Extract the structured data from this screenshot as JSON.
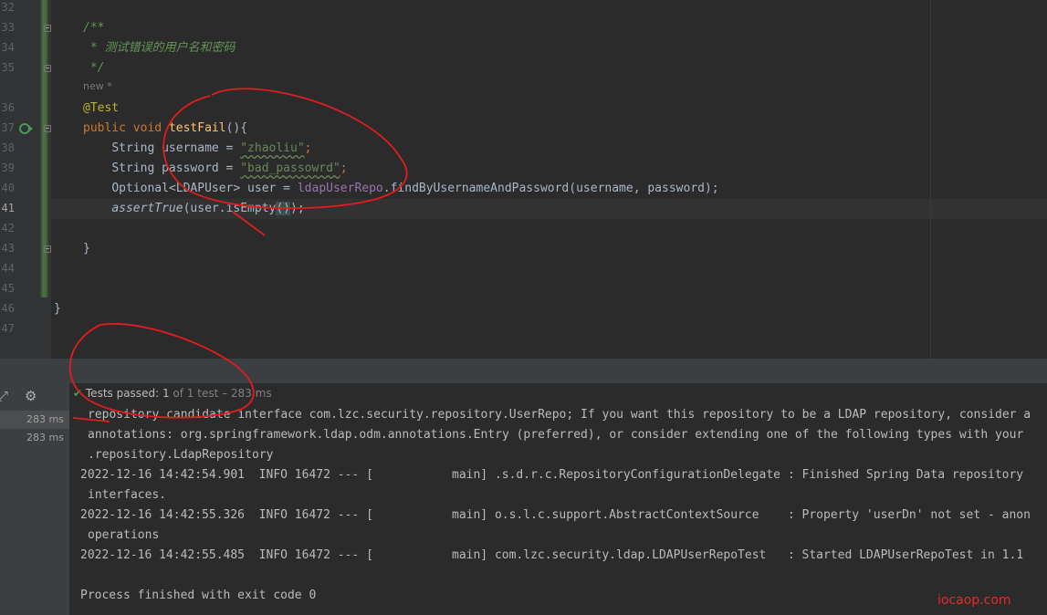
{
  "editor": {
    "line_numbers": [
      "32",
      "33",
      "34",
      "35",
      "36",
      "37",
      "38",
      "39",
      "40",
      "41",
      "42",
      "43",
      "44",
      "45",
      "46",
      "47"
    ],
    "comment_open": "/**",
    "comment_text": " * 测试错误的用户名和密码",
    "comment_close": " */",
    "hint": "new *",
    "annotation": "@Test",
    "kw_public": "public",
    "kw_void": "void",
    "method_name": "testFail",
    "method_sig_end": "(){",
    "type_string": "String",
    "var_username": "username",
    "eq": " = ",
    "str_username": "\"zhaoliu\"",
    "semi": ";",
    "var_password": "password",
    "str_password": "\"bad_passowrd\"",
    "type_optional": "Optional",
    "generic_open": "<",
    "type_ldapuser": "LDAPUser",
    "generic_close": ">",
    "var_user": "user",
    "field_repo": "ldapUserRepo",
    "dot": ".",
    "method_find": "findByUsernameAndPassword",
    "find_args": "(username, password);",
    "assert_call": "assertTrue",
    "assert_open": "(user.",
    "method_isempty": "isEmpty",
    "paren_pair": "()",
    "assert_close": ");",
    "close_method": "}",
    "close_class": "}"
  },
  "test_panel": {
    "status_prefix": "Tests passed:",
    "status_count": "1",
    "status_rest": "of 1 test",
    "status_time": "– 283 ms",
    "side_rows": [
      "283 ms",
      "283 ms"
    ],
    "console_lines": [
      "repository candidate interface com.lzc.security.repository.UserRepo; If you want this repository to be a LDAP repository, consider a",
      "annotations: org.springframework.ldap.odm.annotations.Entry (preferred), or consider extending one of the following types with your",
      ".repository.LdapRepository",
      "2022-12-16 14:42:54.901  INFO 16472 --- [           main] .s.d.r.c.RepositoryConfigurationDelegate : Finished Spring Data repository",
      "interfaces.",
      "2022-12-16 14:42:55.326  INFO 16472 --- [           main] o.s.l.c.support.AbstractContextSource    : Property 'userDn' not set - anon",
      "operations",
      "2022-12-16 14:42:55.485  INFO 16472 --- [           main] com.lzc.security.ldap.LDAPUserRepoTest   : Started LDAPUserRepoTest in 1.1",
      "",
      "Process finished with exit code 0"
    ]
  },
  "watermark": "iocaop.com",
  "icons": {
    "run": "run-test-icon",
    "expand": "expand-icon",
    "settings": "gear-icon",
    "check": "check-icon"
  },
  "colors": {
    "annotation_ink": "#e11d1d",
    "pass_green": "#499c54"
  }
}
